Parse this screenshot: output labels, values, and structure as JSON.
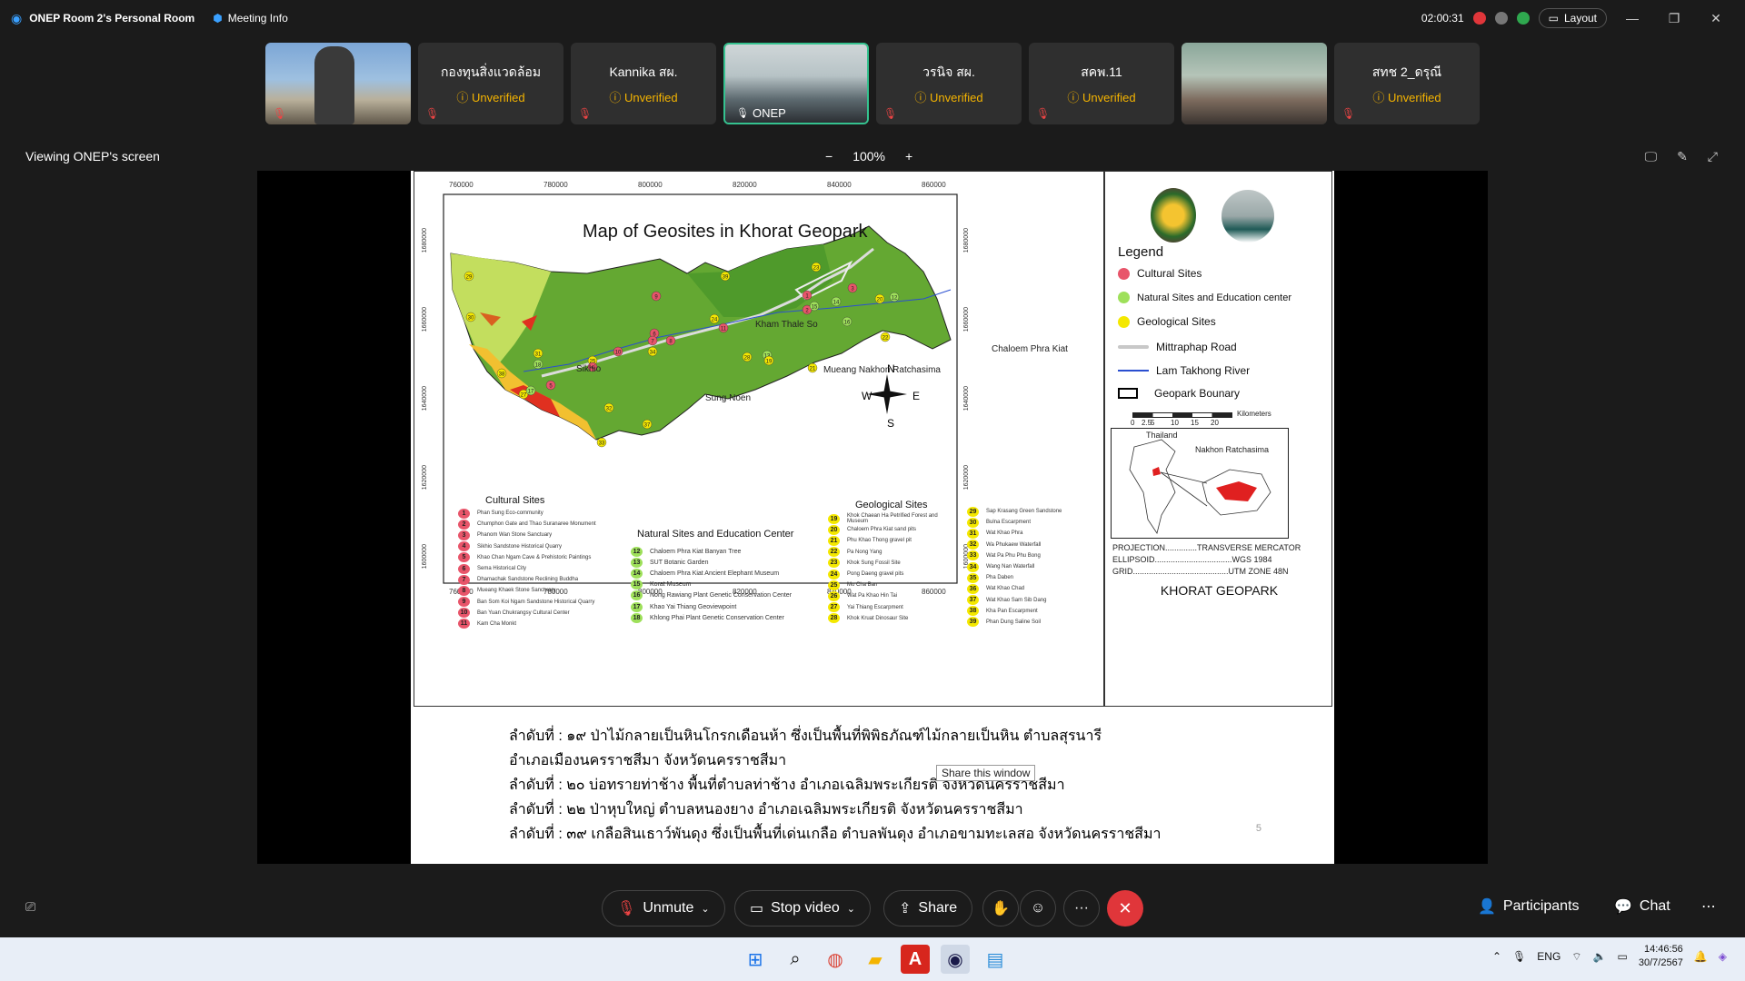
{
  "titlebar": {
    "app_title": "ONEP Room 2's Personal Room",
    "meeting_info": "Meeting Info",
    "timer": "02:00:31",
    "layout_label": "Layout"
  },
  "participants_strip": [
    {
      "name": "",
      "status": "",
      "type": "image"
    },
    {
      "name": "กองทุนสิ่งแวดล้อม",
      "status": "Unverified",
      "type": "tile"
    },
    {
      "name": "Kannika สผ.",
      "status": "Unverified",
      "type": "tile"
    },
    {
      "name": "ONEP",
      "status": "",
      "type": "video"
    },
    {
      "name": "วรนิจ สผ.",
      "status": "Unverified",
      "type": "tile"
    },
    {
      "name": "สคพ.11",
      "status": "Unverified",
      "type": "tile"
    },
    {
      "name": "",
      "status": "",
      "type": "video"
    },
    {
      "name": "สทช 2_ดรุณี",
      "status": "Unverified",
      "type": "tile"
    }
  ],
  "share": {
    "viewing_label": "Viewing ONEP's screen",
    "zoom_level": "100%",
    "zoom_out": "−",
    "zoom_in": "+"
  },
  "slide": {
    "map_title": "Map of Geosites in Khorat Geopark",
    "legend": {
      "title": "Legend",
      "items": [
        {
          "label": "Cultural Sites",
          "color": "#e8556a"
        },
        {
          "label": "Natural Sites and Education center",
          "color": "#9ee05a"
        },
        {
          "label": "Geological Sites",
          "color": "#f4e800"
        },
        {
          "label": "Mittraphap Road",
          "color": "#c8c8c8"
        },
        {
          "label": "Lam Takhong River",
          "color": "#2a4fd0"
        },
        {
          "label": "Geopark Bounary",
          "color": "#000000"
        }
      ],
      "scale_label": "Kilometers",
      "scale_ticks": [
        "0",
        "2.5",
        "5",
        "10",
        "15",
        "20"
      ],
      "inset_labels": [
        "Thailand",
        "Nakhon Ratchasima"
      ],
      "projection": "PROJECTION..............TRANSVERSE MERCATOR",
      "ellipsoid": "ELLIPSOID..................................WGS 1984",
      "grid": "GRID..........................................UTM ZONE 48N",
      "footer": "KHORAT GEOPARK"
    },
    "axis_x": [
      "760000",
      "780000",
      "800000",
      "820000",
      "840000",
      "860000"
    ],
    "axis_y": [
      "1680000",
      "1660000",
      "1640000",
      "1620000",
      "1600000"
    ],
    "place_names": [
      "Kham Thale So",
      "Sikhio",
      "Mueang Nakhon Ratchasima",
      "Chaloem Phra Kiat",
      "Sung Noen"
    ],
    "compass": [
      "N",
      "S",
      "W",
      "E"
    ],
    "cultural_title": "Cultural Sites",
    "natural_title": "Natural Sites and Education Center",
    "geological_title": "Geological Sites",
    "cultural_list": [
      {
        "n": "1",
        "t": "Phan Sung Eco-community"
      },
      {
        "n": "2",
        "t": "Chumphon Gate and Thao Suranaree Monument"
      },
      {
        "n": "3",
        "t": "Phanom Wan Stone Sanctuary"
      },
      {
        "n": "4",
        "t": "Sikhio Sandstone Historical Quarry"
      },
      {
        "n": "5",
        "t": "Khao Chan Ngam Cave & Prehistoric Paintings"
      },
      {
        "n": "6",
        "t": "Sema Historical City"
      },
      {
        "n": "7",
        "t": "Dhamachak Sandstone Reclining Buddha"
      },
      {
        "n": "8",
        "t": "Mueang Khaek Stone Sanctuary"
      },
      {
        "n": "9",
        "t": "Ban Som Koi Ngam Sandstone Historical Quarry"
      },
      {
        "n": "10",
        "t": "Ban Yuan Chukrangsy Cultural Center"
      },
      {
        "n": "11",
        "t": "Kam Cha Monkt"
      }
    ],
    "natural_list": [
      {
        "n": "12",
        "t": "Chaloem Phra Kiat Banyan Tree"
      },
      {
        "n": "13",
        "t": "SUT Botanic Garden"
      },
      {
        "n": "14",
        "t": "Chaloem Phra Kiat Ancient Elephant Museum"
      },
      {
        "n": "15",
        "t": "Korat Museum"
      },
      {
        "n": "16",
        "t": "Nong Rawiang Plant Genetic Conservation Center"
      },
      {
        "n": "17",
        "t": "Khao Yai Thiang Geoviewpoint"
      },
      {
        "n": "18",
        "t": "Khlong Phai Plant Genetic Conservation Center"
      }
    ],
    "geo_list_a": [
      {
        "n": "19",
        "t": "Khok Chaean Ha Petrified Forest and Museum"
      },
      {
        "n": "20",
        "t": "Chaloem Phra Kiat sand pits"
      },
      {
        "n": "21",
        "t": "Phu Khao Thong gravel pit"
      },
      {
        "n": "22",
        "t": "Pa Nong Yang"
      },
      {
        "n": "23",
        "t": "Khok Sung Fossil Site"
      },
      {
        "n": "24",
        "t": "Pong Daeng gravel pits"
      },
      {
        "n": "25",
        "t": "Mo Cha Ban"
      },
      {
        "n": "26",
        "t": "Wat Pa Khao Hin Tai"
      },
      {
        "n": "27",
        "t": "Yai Thiang Escarpment"
      },
      {
        "n": "28",
        "t": "Khok Kruat Dinosaur Site"
      }
    ],
    "geo_list_b": [
      {
        "n": "29",
        "t": "Sap Krasang Green Sandstone"
      },
      {
        "n": "30",
        "t": "Bulna Escarpment"
      },
      {
        "n": "31",
        "t": "Wat Khao Phra"
      },
      {
        "n": "32",
        "t": "Wa Phukaew Waterfall"
      },
      {
        "n": "33",
        "t": "Wat Pa Phu Phu Bong"
      },
      {
        "n": "34",
        "t": "Wang Nan Waterfall"
      },
      {
        "n": "35",
        "t": "Pha Daben"
      },
      {
        "n": "36",
        "t": "Wat Khao Chad"
      },
      {
        "n": "37",
        "t": "Wat Khao Sam Sib Dang"
      },
      {
        "n": "38",
        "t": "Kha Pan Escarpment"
      },
      {
        "n": "39",
        "t": "Phan Dung Saline Soil"
      }
    ],
    "text_lines": [
      "ลำดับที่ : ๑๙ ป่าไม้กลายเป็นหินโกรกเดือนห้า ซึ่งเป็นพื้นที่พิพิธภัณฑ์ไม้กลายเป็นหิน ตำบลสุรนารี",
      "อำเภอเมืองนครราชสีมา จังหวัดนครราชสีมา",
      "ลำดับที่ : ๒๐ บ่อทรายท่าช้าง พื้นที่ตำบลท่าช้าง อำเภอเฉลิมพระเกียรติ จังหวัดนครราชสีมา",
      "ลำดับที่ : ๒๒ ป่าหุบใหญ่ ตำบลหนองยาง อำเภอเฉลิมพระเกียรติ จังหวัดนครราชสีมา",
      "ลำดับที่ : ๓๙ เกลือสินเธาว์พันดุง ซึ่งเป็นพื้นที่เด่นเกลือ ตำบลพันดุง อำเภอขามทะเลสอ จังหวัดนครราชสีมา"
    ],
    "page_number": "5"
  },
  "tooltip": "Share this window",
  "controls": {
    "unmute": "Unmute",
    "stop_video": "Stop video",
    "share": "Share",
    "more": "···",
    "participants": "Participants",
    "chat": "Chat"
  },
  "taskbar": {
    "lang": "ENG",
    "time": "14:46:56",
    "date": "30/7/2567"
  }
}
